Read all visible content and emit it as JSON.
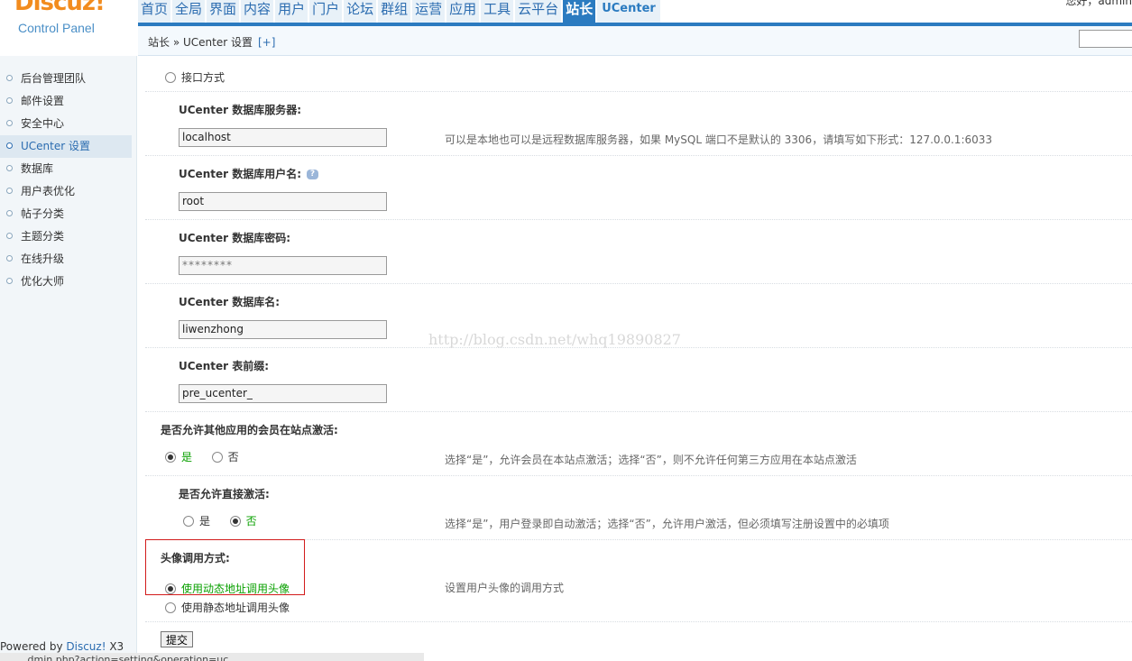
{
  "header": {
    "logo_brand": "Discuz!",
    "logo_sub": "Control Panel",
    "user_greeting": "您好，admin",
    "nav": [
      "首页",
      "全局",
      "界面",
      "内容",
      "用户",
      "门户",
      "论坛",
      "群组",
      "运营",
      "应用",
      "工具",
      "云平台",
      "站长",
      "UCenter"
    ],
    "active_nav": "站长"
  },
  "breadcrumb": {
    "text": "站长 » UCenter 设置",
    "plus": "[+]"
  },
  "sidebar": {
    "items": [
      "后台管理团队",
      "邮件设置",
      "安全中心",
      "UCenter 设置",
      "数据库",
      "用户表优化",
      "帖子分类",
      "主题分类",
      "在线升级",
      "优化大师"
    ],
    "active": "UCenter 设置"
  },
  "powered": {
    "prefix": "Powered by ",
    "brand": "Discuz!",
    "version": " X3"
  },
  "form": {
    "connect_mode": "接口方式",
    "db_server_label": "UCenter 数据库服务器:",
    "db_server_value": "localhost",
    "db_server_tip": "可以是本地也可以是远程数据库服务器，如果 MySQL 端口不是默认的 3306，请填写如下形式：127.0.0.1:6033",
    "db_user_label": "UCenter 数据库用户名:",
    "db_user_value": "root",
    "db_pass_label": "UCenter 数据库密码:",
    "db_pass_value": "********",
    "db_name_label": "UCenter 数据库名:",
    "db_name_value": "liwenzhong",
    "prefix_label": "UCenter 表前缀:",
    "prefix_value": "pre_ucenter_",
    "allow_other_label": "是否允许其他应用的会员在站点激活:",
    "allow_other_yes": "是",
    "allow_other_no": "否",
    "allow_other_tip": "选择“是”，允许会员在本站点激活；选择“否”，则不允许任何第三方应用在本站点激活",
    "direct_label": "是否允许直接激活:",
    "direct_yes": "是",
    "direct_no": "否",
    "direct_tip": "选择“是”，用户登录即自动激活；选择“否”，允许用户激活，但必须填写注册设置中的必填项",
    "avatar_label": "头像调用方式:",
    "avatar_dynamic": "使用动态地址调用头像",
    "avatar_static": "使用静态地址调用头像",
    "avatar_tip": "设置用户头像的调用方式",
    "submit": "提交"
  },
  "watermark": "http://blog.csdn.net/whq19890827",
  "statusbar": "...dmin.php?action=setting&operation=uc..."
}
